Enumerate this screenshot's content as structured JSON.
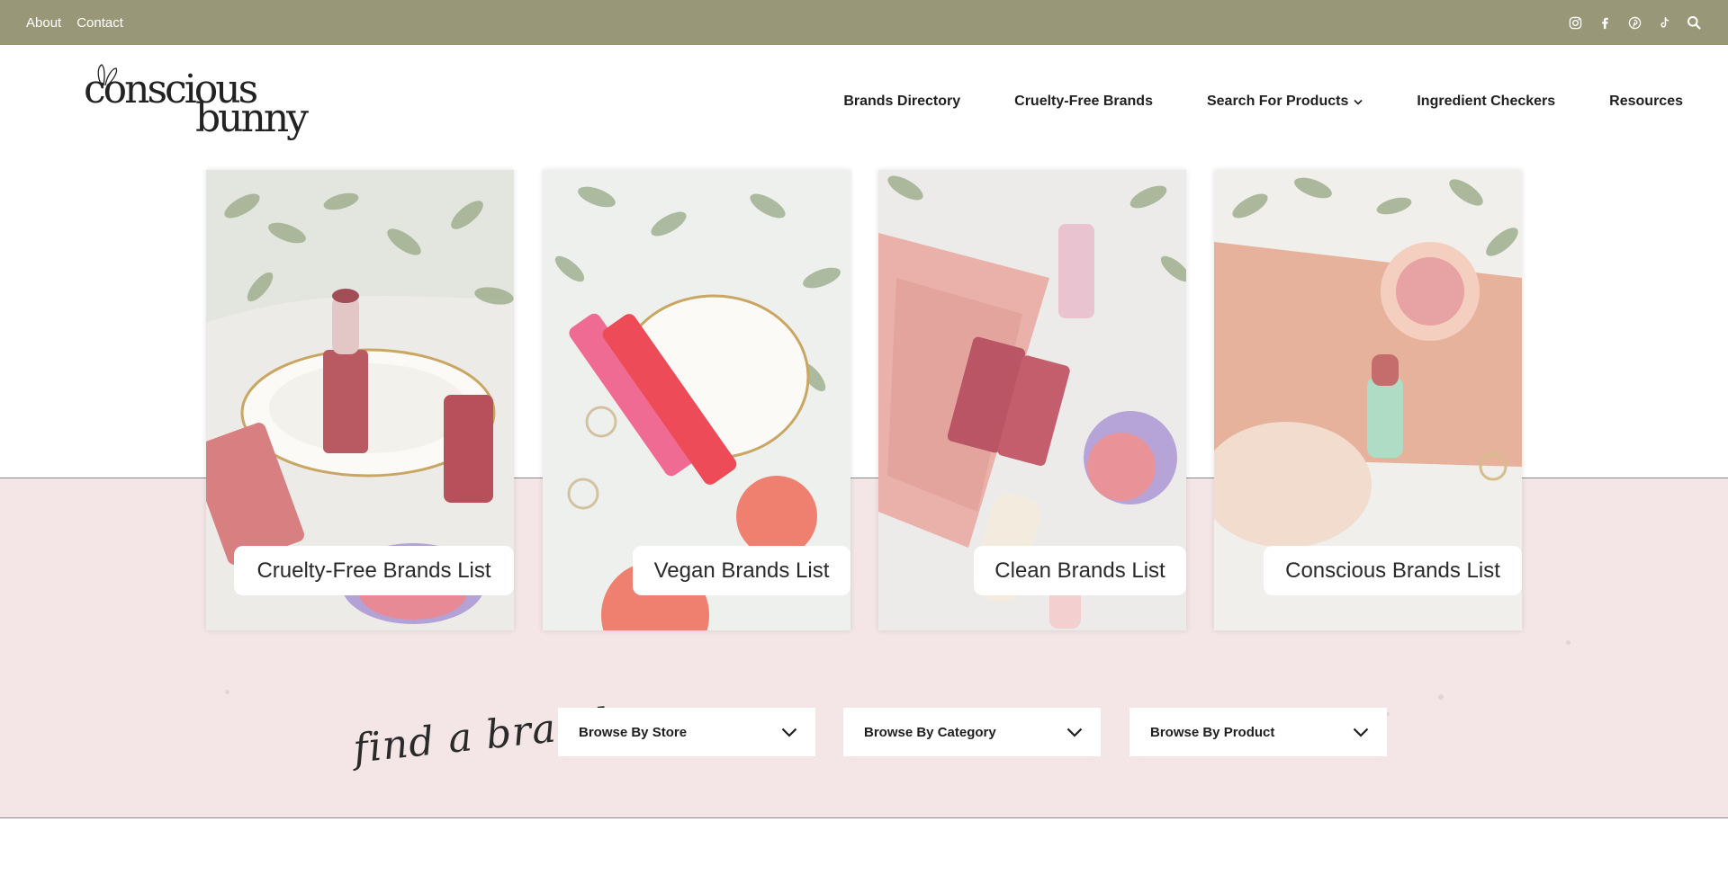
{
  "topbar": {
    "links": [
      {
        "label": "About"
      },
      {
        "label": "Contact"
      }
    ],
    "social_icons": [
      "instagram-icon",
      "facebook-icon",
      "pinterest-icon",
      "tiktok-icon",
      "search-icon"
    ],
    "background": "#989878"
  },
  "header": {
    "logo": {
      "line1": "conscious",
      "line2": "bunny"
    },
    "nav": [
      {
        "label": "Brands Directory"
      },
      {
        "label": "Cruelty-Free Brands"
      },
      {
        "label": "Search For Products",
        "has_dropdown": true
      },
      {
        "label": "Ingredient Checkers"
      },
      {
        "label": "Resources"
      }
    ]
  },
  "cards": [
    {
      "label": "Cruelty-Free Brands List",
      "image": "lipstick-and-gloss-on-scalloped-dish"
    },
    {
      "label": "Vegan Brands List",
      "image": "pink-lip-tubes-on-shell-dish"
    },
    {
      "label": "Clean Brands List",
      "image": "pink-pouch-with-lip-products-and-blush"
    },
    {
      "label": "Conscious Brands List",
      "image": "compact-blush-and-lipstick"
    }
  ],
  "find_brand": {
    "heading": "find a brand",
    "dropdowns": [
      {
        "label": "Browse By Store"
      },
      {
        "label": "Browse By Category"
      },
      {
        "label": "Browse By Product"
      }
    ]
  },
  "colors": {
    "band": "#f4e6e6",
    "topbar": "#989878"
  }
}
